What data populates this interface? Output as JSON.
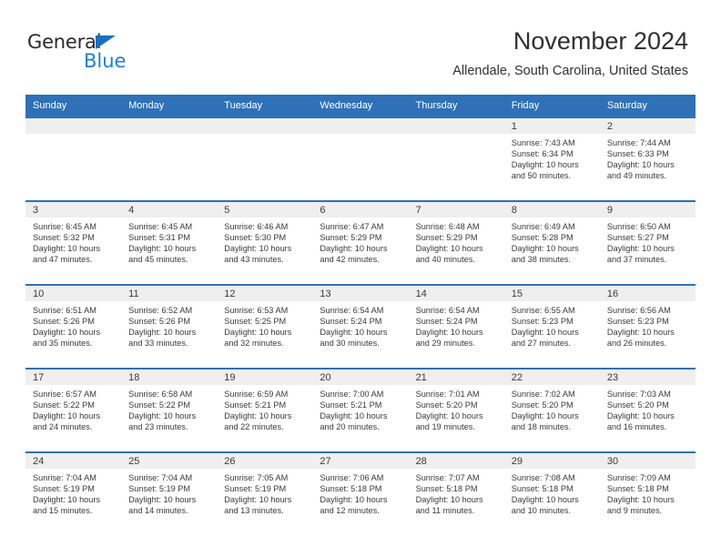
{
  "brand": {
    "name_top": "General",
    "name_bottom": "Blue",
    "triangle_color": "#1a6fc4",
    "blue_color": "#1a7fd4"
  },
  "header": {
    "title": "November 2024",
    "subtitle": "Allendale, South Carolina, United States"
  },
  "theme": {
    "header_blue": "#2e71b8",
    "date_band_gray": "#efefef",
    "text_color": "#3a3a3a"
  },
  "weekdays": [
    "Sunday",
    "Monday",
    "Tuesday",
    "Wednesday",
    "Thursday",
    "Friday",
    "Saturday"
  ],
  "labels": {
    "sunrise_prefix": "Sunrise:",
    "sunset_prefix": "Sunset:",
    "daylight_prefix": "Daylight:"
  },
  "weeks": [
    [
      {
        "day": "",
        "sunrise": "",
        "sunset": "",
        "daylight_line1": "",
        "daylight_line2": ""
      },
      {
        "day": "",
        "sunrise": "",
        "sunset": "",
        "daylight_line1": "",
        "daylight_line2": ""
      },
      {
        "day": "",
        "sunrise": "",
        "sunset": "",
        "daylight_line1": "",
        "daylight_line2": ""
      },
      {
        "day": "",
        "sunrise": "",
        "sunset": "",
        "daylight_line1": "",
        "daylight_line2": ""
      },
      {
        "day": "",
        "sunrise": "",
        "sunset": "",
        "daylight_line1": "",
        "daylight_line2": ""
      },
      {
        "day": "1",
        "sunrise": "Sunrise: 7:43 AM",
        "sunset": "Sunset: 6:34 PM",
        "daylight_line1": "Daylight: 10 hours",
        "daylight_line2": "and 50 minutes."
      },
      {
        "day": "2",
        "sunrise": "Sunrise: 7:44 AM",
        "sunset": "Sunset: 6:33 PM",
        "daylight_line1": "Daylight: 10 hours",
        "daylight_line2": "and 49 minutes."
      }
    ],
    [
      {
        "day": "3",
        "sunrise": "Sunrise: 6:45 AM",
        "sunset": "Sunset: 5:32 PM",
        "daylight_line1": "Daylight: 10 hours",
        "daylight_line2": "and 47 minutes."
      },
      {
        "day": "4",
        "sunrise": "Sunrise: 6:45 AM",
        "sunset": "Sunset: 5:31 PM",
        "daylight_line1": "Daylight: 10 hours",
        "daylight_line2": "and 45 minutes."
      },
      {
        "day": "5",
        "sunrise": "Sunrise: 6:46 AM",
        "sunset": "Sunset: 5:30 PM",
        "daylight_line1": "Daylight: 10 hours",
        "daylight_line2": "and 43 minutes."
      },
      {
        "day": "6",
        "sunrise": "Sunrise: 6:47 AM",
        "sunset": "Sunset: 5:29 PM",
        "daylight_line1": "Daylight: 10 hours",
        "daylight_line2": "and 42 minutes."
      },
      {
        "day": "7",
        "sunrise": "Sunrise: 6:48 AM",
        "sunset": "Sunset: 5:29 PM",
        "daylight_line1": "Daylight: 10 hours",
        "daylight_line2": "and 40 minutes."
      },
      {
        "day": "8",
        "sunrise": "Sunrise: 6:49 AM",
        "sunset": "Sunset: 5:28 PM",
        "daylight_line1": "Daylight: 10 hours",
        "daylight_line2": "and 38 minutes."
      },
      {
        "day": "9",
        "sunrise": "Sunrise: 6:50 AM",
        "sunset": "Sunset: 5:27 PM",
        "daylight_line1": "Daylight: 10 hours",
        "daylight_line2": "and 37 minutes."
      }
    ],
    [
      {
        "day": "10",
        "sunrise": "Sunrise: 6:51 AM",
        "sunset": "Sunset: 5:26 PM",
        "daylight_line1": "Daylight: 10 hours",
        "daylight_line2": "and 35 minutes."
      },
      {
        "day": "11",
        "sunrise": "Sunrise: 6:52 AM",
        "sunset": "Sunset: 5:26 PM",
        "daylight_line1": "Daylight: 10 hours",
        "daylight_line2": "and 33 minutes."
      },
      {
        "day": "12",
        "sunrise": "Sunrise: 6:53 AM",
        "sunset": "Sunset: 5:25 PM",
        "daylight_line1": "Daylight: 10 hours",
        "daylight_line2": "and 32 minutes."
      },
      {
        "day": "13",
        "sunrise": "Sunrise: 6:54 AM",
        "sunset": "Sunset: 5:24 PM",
        "daylight_line1": "Daylight: 10 hours",
        "daylight_line2": "and 30 minutes."
      },
      {
        "day": "14",
        "sunrise": "Sunrise: 6:54 AM",
        "sunset": "Sunset: 5:24 PM",
        "daylight_line1": "Daylight: 10 hours",
        "daylight_line2": "and 29 minutes."
      },
      {
        "day": "15",
        "sunrise": "Sunrise: 6:55 AM",
        "sunset": "Sunset: 5:23 PM",
        "daylight_line1": "Daylight: 10 hours",
        "daylight_line2": "and 27 minutes."
      },
      {
        "day": "16",
        "sunrise": "Sunrise: 6:56 AM",
        "sunset": "Sunset: 5:23 PM",
        "daylight_line1": "Daylight: 10 hours",
        "daylight_line2": "and 26 minutes."
      }
    ],
    [
      {
        "day": "17",
        "sunrise": "Sunrise: 6:57 AM",
        "sunset": "Sunset: 5:22 PM",
        "daylight_line1": "Daylight: 10 hours",
        "daylight_line2": "and 24 minutes."
      },
      {
        "day": "18",
        "sunrise": "Sunrise: 6:58 AM",
        "sunset": "Sunset: 5:22 PM",
        "daylight_line1": "Daylight: 10 hours",
        "daylight_line2": "and 23 minutes."
      },
      {
        "day": "19",
        "sunrise": "Sunrise: 6:59 AM",
        "sunset": "Sunset: 5:21 PM",
        "daylight_line1": "Daylight: 10 hours",
        "daylight_line2": "and 22 minutes."
      },
      {
        "day": "20",
        "sunrise": "Sunrise: 7:00 AM",
        "sunset": "Sunset: 5:21 PM",
        "daylight_line1": "Daylight: 10 hours",
        "daylight_line2": "and 20 minutes."
      },
      {
        "day": "21",
        "sunrise": "Sunrise: 7:01 AM",
        "sunset": "Sunset: 5:20 PM",
        "daylight_line1": "Daylight: 10 hours",
        "daylight_line2": "and 19 minutes."
      },
      {
        "day": "22",
        "sunrise": "Sunrise: 7:02 AM",
        "sunset": "Sunset: 5:20 PM",
        "daylight_line1": "Daylight: 10 hours",
        "daylight_line2": "and 18 minutes."
      },
      {
        "day": "23",
        "sunrise": "Sunrise: 7:03 AM",
        "sunset": "Sunset: 5:20 PM",
        "daylight_line1": "Daylight: 10 hours",
        "daylight_line2": "and 16 minutes."
      }
    ],
    [
      {
        "day": "24",
        "sunrise": "Sunrise: 7:04 AM",
        "sunset": "Sunset: 5:19 PM",
        "daylight_line1": "Daylight: 10 hours",
        "daylight_line2": "and 15 minutes."
      },
      {
        "day": "25",
        "sunrise": "Sunrise: 7:04 AM",
        "sunset": "Sunset: 5:19 PM",
        "daylight_line1": "Daylight: 10 hours",
        "daylight_line2": "and 14 minutes."
      },
      {
        "day": "26",
        "sunrise": "Sunrise: 7:05 AM",
        "sunset": "Sunset: 5:19 PM",
        "daylight_line1": "Daylight: 10 hours",
        "daylight_line2": "and 13 minutes."
      },
      {
        "day": "27",
        "sunrise": "Sunrise: 7:06 AM",
        "sunset": "Sunset: 5:18 PM",
        "daylight_line1": "Daylight: 10 hours",
        "daylight_line2": "and 12 minutes."
      },
      {
        "day": "28",
        "sunrise": "Sunrise: 7:07 AM",
        "sunset": "Sunset: 5:18 PM",
        "daylight_line1": "Daylight: 10 hours",
        "daylight_line2": "and 11 minutes."
      },
      {
        "day": "29",
        "sunrise": "Sunrise: 7:08 AM",
        "sunset": "Sunset: 5:18 PM",
        "daylight_line1": "Daylight: 10 hours",
        "daylight_line2": "and 10 minutes."
      },
      {
        "day": "30",
        "sunrise": "Sunrise: 7:09 AM",
        "sunset": "Sunset: 5:18 PM",
        "daylight_line1": "Daylight: 10 hours",
        "daylight_line2": "and 9 minutes."
      }
    ]
  ]
}
